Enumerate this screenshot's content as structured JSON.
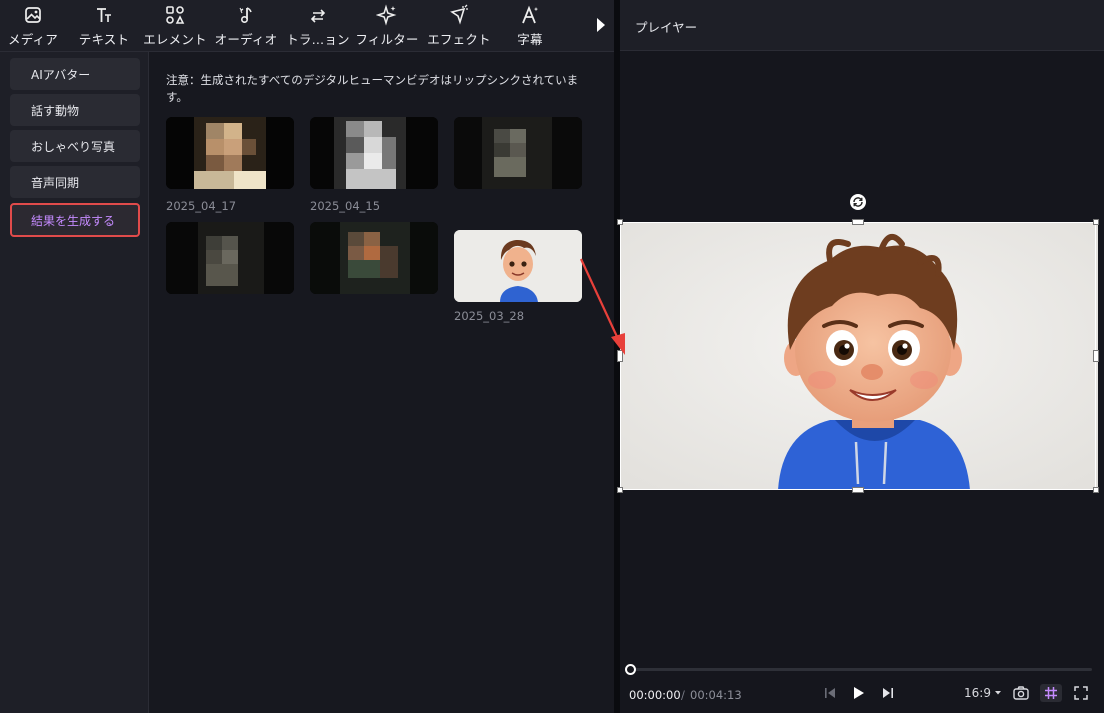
{
  "toolbar": {
    "tabs": [
      {
        "label": "メディア",
        "icon": "media-icon"
      },
      {
        "label": "テキスト",
        "icon": "text-icon"
      },
      {
        "label": "エレメント",
        "icon": "element-icon"
      },
      {
        "label": "オーディオ",
        "icon": "audio-icon"
      },
      {
        "label": "トラ…ョン",
        "icon": "transition-icon"
      },
      {
        "label": "フィルター",
        "icon": "filter-icon"
      },
      {
        "label": "エフェクト",
        "icon": "effect-icon"
      },
      {
        "label": "字幕",
        "icon": "subtitle-icon"
      }
    ],
    "more_icon": "caret-right-icon"
  },
  "sidebar": {
    "items": [
      {
        "label": "AIアバター",
        "active": false
      },
      {
        "label": "話す動物",
        "active": false
      },
      {
        "label": "おしゃべり写真",
        "active": false
      },
      {
        "label": "音声同期",
        "active": false
      },
      {
        "label": "結果を生成する",
        "active": true
      }
    ]
  },
  "content": {
    "notice": "注意：生成されたすべてのデジタルヒューマンビデオはリップシンクされています。",
    "thumbnails": [
      {
        "date": "2025_04_17",
        "blurred": true
      },
      {
        "date": "2025_04_15",
        "blurred": true
      },
      {
        "date": "",
        "blurred": true
      },
      {
        "date": "",
        "blurred": true
      },
      {
        "date": "",
        "blurred": true
      },
      {
        "date": "2025_03_28",
        "blurred": false
      }
    ]
  },
  "player": {
    "title": "プレイヤー",
    "time_current": "00:00:00",
    "time_separator": "/",
    "time_total": "00:04:13",
    "aspect_ratio": "16:9",
    "progress": 0,
    "controls": [
      "prev-frame-icon",
      "play-icon",
      "next-frame-icon",
      "camera-icon",
      "grid-icon",
      "fullscreen-icon"
    ]
  },
  "colors": {
    "accent_purple": "#c58bff",
    "highlight_red": "#e14b4b",
    "panel": "#1e1f27",
    "background": "#17181f"
  }
}
